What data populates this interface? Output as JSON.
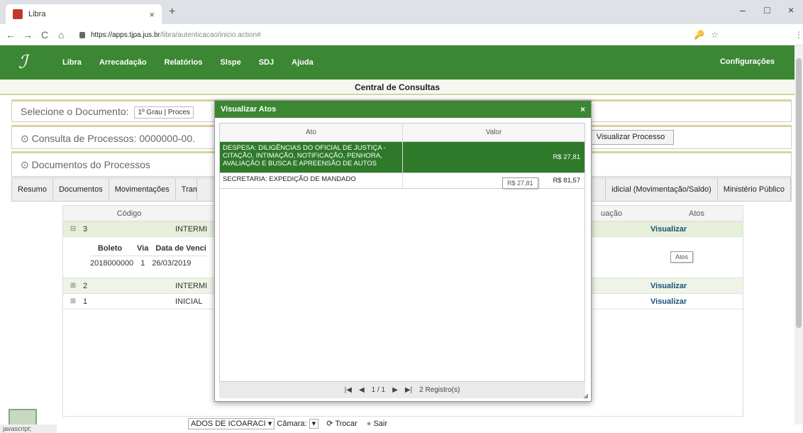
{
  "browser": {
    "tab_title": "Libra",
    "tab_close": "×",
    "new_tab": "+",
    "url_host": "https://apps.tjpa.jus.br",
    "url_path": "/libra/autenticacao/inicio.action#",
    "nav_back": "←",
    "nav_forward": "→",
    "nav_reload": "C",
    "nav_home": "⌂",
    "win_minimize": "–",
    "win_maximize": "□",
    "win_close": "×",
    "key_icon": "🔑",
    "star_icon": "☆",
    "menu_icon": "⋮"
  },
  "app_nav": {
    "items": [
      "Libra",
      "Arrecadação",
      "Relatórios",
      "Slspe",
      "SDJ",
      "Ajuda"
    ],
    "settings": "Configurações"
  },
  "central_title": "Central de Consultas",
  "select_doc": {
    "label": "Selecione o Documento:",
    "value": "1º Grau | Proces"
  },
  "consulta": {
    "label": "Consulta de Processos: 0000000-00.",
    "view_button": "Visualizar Processo"
  },
  "documentos": {
    "label": "Documentos do Processos"
  },
  "tabs": [
    "Resumo",
    "Documentos",
    "Movimentações",
    "Tram",
    "idicial (Movimentação/Saldo)",
    "Ministério Público"
  ],
  "grid": {
    "headers": {
      "codigo": "Código",
      "situacao": "uação",
      "atos": "Atos"
    },
    "rows": [
      {
        "exp": "⊟",
        "code": "3",
        "tipo": "INTERMI",
        "atos": "Visualizar"
      },
      {
        "exp": "⊞",
        "code": "2",
        "tipo": "INTERMI",
        "atos": "Visualizar"
      },
      {
        "exp": "⊞",
        "code": "1",
        "tipo": "INICIAL",
        "atos": "Visualizar"
      }
    ],
    "sub": {
      "headers": [
        "Boleto",
        "Via",
        "Data de Venci"
      ],
      "values": [
        "2018000000",
        "1",
        "26/03/2019"
      ]
    },
    "tooltip_atos": "Atos"
  },
  "modal": {
    "title": "Visualizar Atos",
    "close": "×",
    "col_ato": "Ato",
    "col_valor": "Valor",
    "rows": [
      {
        "ato": "DESPESA: DILIGÊNCIAS DO OFICIAL DE JUSTIÇA - CITAÇÃO, INTIMAÇÃO, NOTIFICAÇÃO, PENHORA, AVALIAÇÃO E BUSCA E APREENSÃO DE AUTOS",
        "valor": "R$ 27,81"
      },
      {
        "ato": "SECRETARIA: EXPEDIÇÃO DE MANDADO",
        "valor": "R$ 81,57"
      }
    ],
    "tooltip_valor": "R$ 27,81",
    "pager": {
      "first": "|◀",
      "prev": "◀",
      "page": "1 / 1",
      "next": "▶",
      "last": "▶|",
      "count": "2 Registro(s)"
    }
  },
  "bottom": {
    "org": "ADOS DE ICOARACI ▾",
    "camara_label": "Câmara:",
    "camara_value": "▾",
    "trocar": "Trocar",
    "sair": "Sair"
  },
  "status_text": "javascript;"
}
